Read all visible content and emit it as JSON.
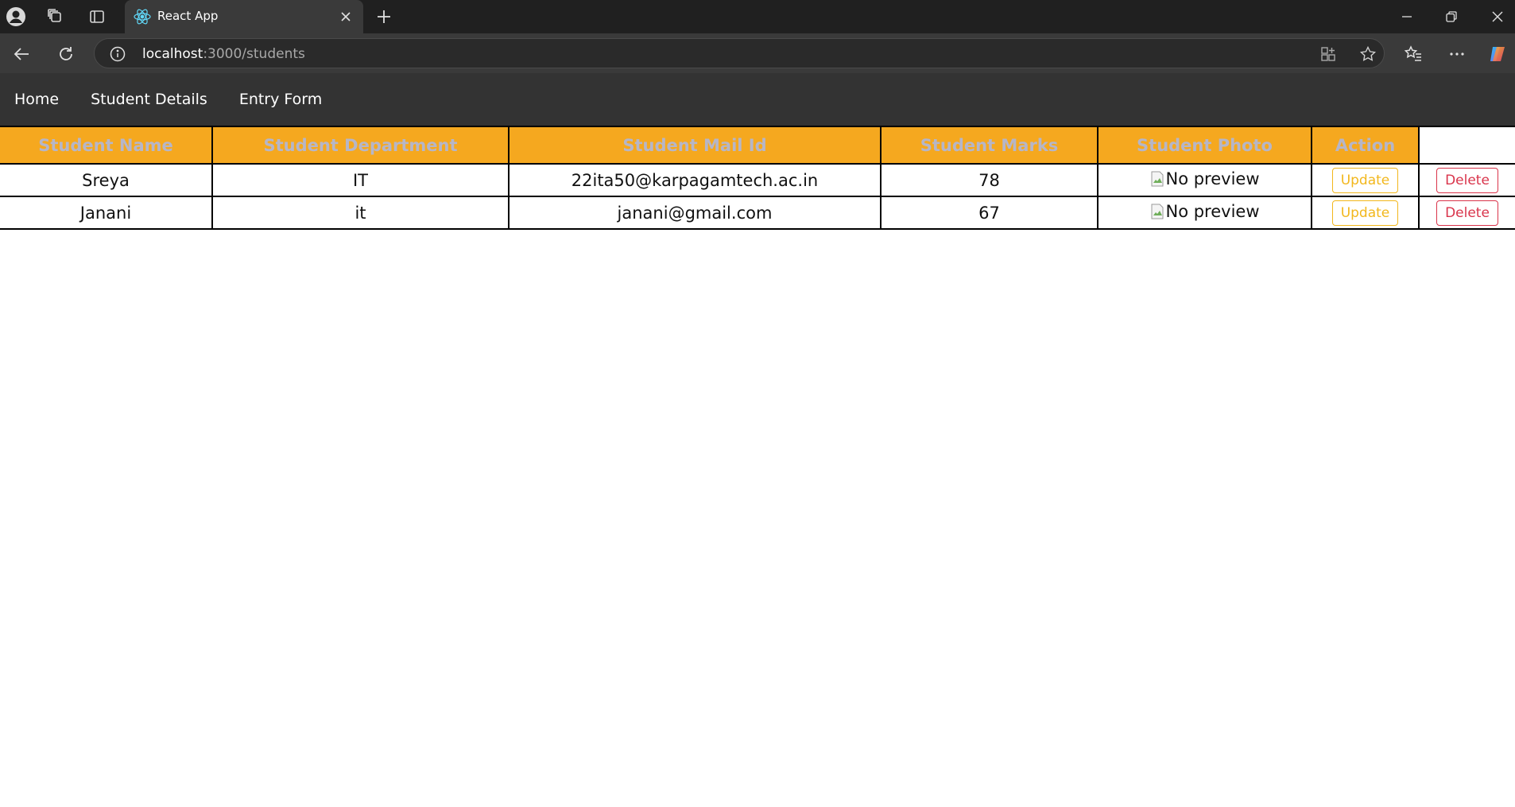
{
  "browser": {
    "tab_title": "React App",
    "url_host": "localhost",
    "url_rest": ":3000/students"
  },
  "nav": {
    "links": [
      "Home",
      "Student Details",
      "Entry Form"
    ]
  },
  "table": {
    "headers": [
      "Student Name",
      "Student Department",
      "Student Mail Id",
      "Student Marks",
      "Student Photo",
      "Action"
    ],
    "rows": [
      {
        "name": "Sreya",
        "department": "IT",
        "mail": "22ita50@karpagamtech.ac.in",
        "marks": "78",
        "photo_alt": "No preview",
        "update": "Update",
        "delete": "Delete"
      },
      {
        "name": "Janani",
        "department": "it",
        "mail": "janani@gmail.com",
        "marks": "67",
        "photo_alt": "No preview",
        "update": "Update",
        "delete": "Delete"
      }
    ]
  },
  "colors": {
    "header_bg": "#f5a81f",
    "header_text": "#b6b6c8",
    "nav_bg": "#333333",
    "update": "#f2b71c",
    "delete": "#d9344b"
  }
}
